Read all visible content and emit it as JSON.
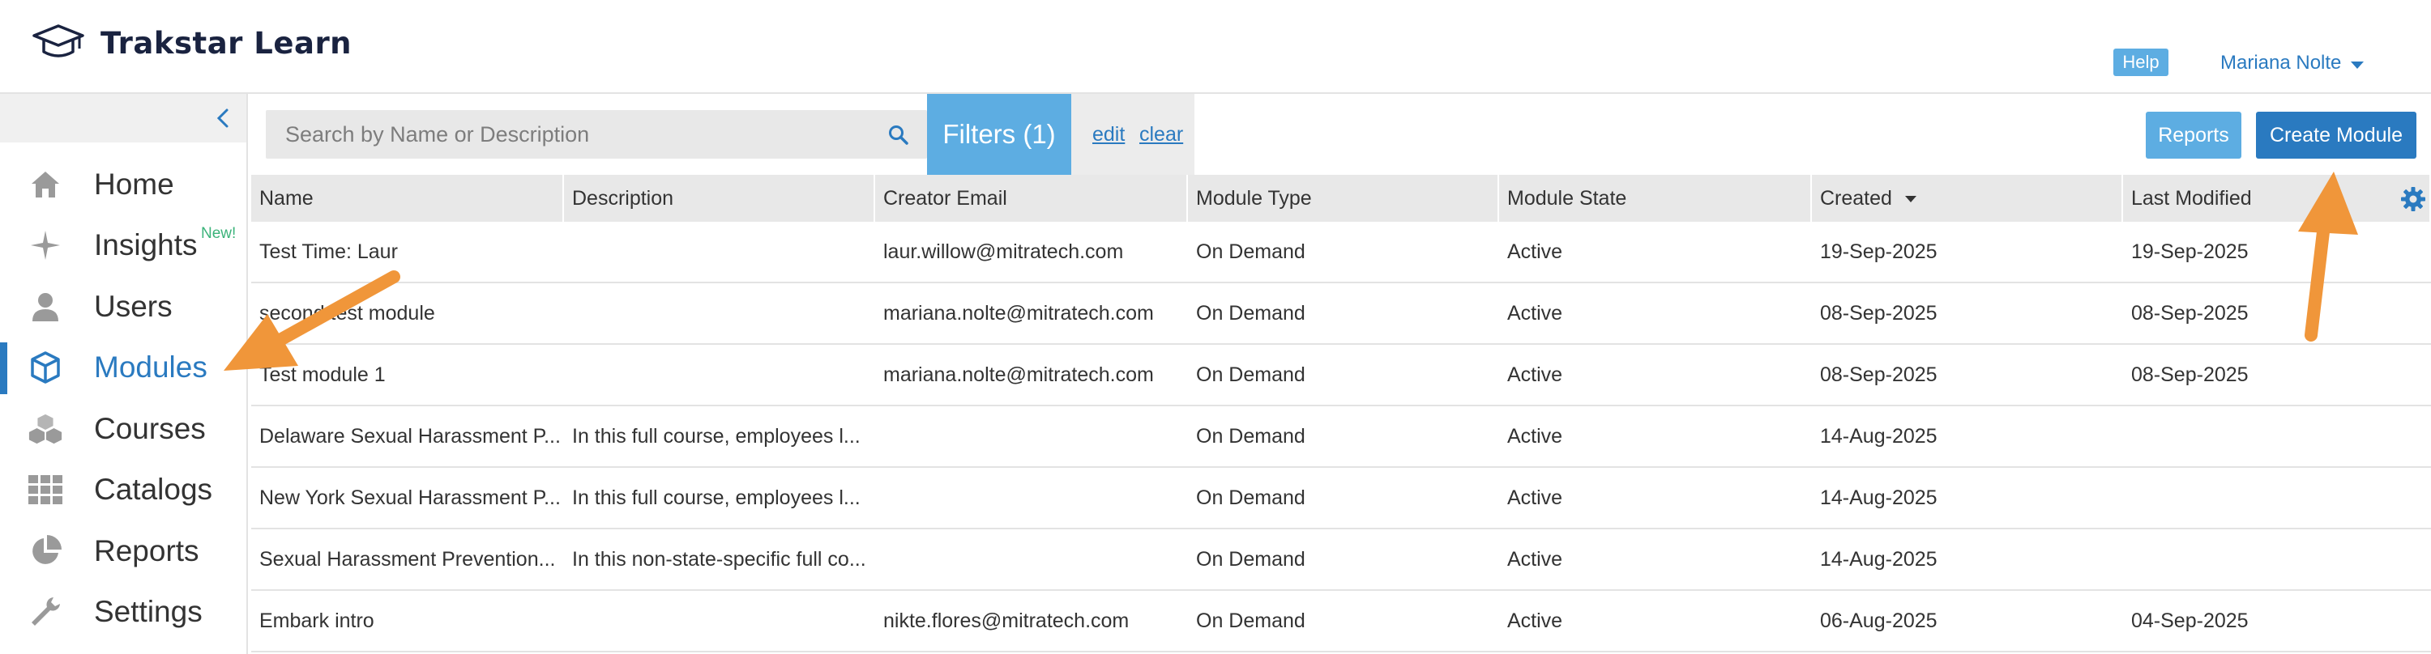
{
  "app": {
    "title": "Trakstar Learn",
    "help_label": "Help",
    "user_name": "Mariana Nolte"
  },
  "sidebar": {
    "items": [
      {
        "label": "Home",
        "icon": "home-icon"
      },
      {
        "label": "Insights",
        "icon": "sparkle-icon",
        "badge": "New!"
      },
      {
        "label": "Users",
        "icon": "user-icon"
      },
      {
        "label": "Modules",
        "icon": "cube-icon",
        "active": true
      },
      {
        "label": "Courses",
        "icon": "cubes-icon"
      },
      {
        "label": "Catalogs",
        "icon": "grid-icon"
      },
      {
        "label": "Reports",
        "icon": "pie-chart-icon"
      },
      {
        "label": "Settings",
        "icon": "wrench-icon"
      }
    ]
  },
  "toolbar": {
    "search_placeholder": "Search by Name or Description",
    "filters_label": "Filters (1)",
    "edit_label": "edit",
    "clear_label": "clear",
    "reports_label": "Reports",
    "create_label": "Create Module"
  },
  "table": {
    "columns": [
      "Name",
      "Description",
      "Creator Email",
      "Module Type",
      "Module State",
      "Created",
      "Last Modified"
    ],
    "rows": [
      [
        "Test Time: Laur",
        "",
        "laur.willow@mitratech.com",
        "On Demand",
        "Active",
        "19-Sep-2025",
        "19-Sep-2025"
      ],
      [
        "second test module",
        "",
        "mariana.nolte@mitratech.com",
        "On Demand",
        "Active",
        "08-Sep-2025",
        "08-Sep-2025"
      ],
      [
        "Test module 1",
        "",
        "mariana.nolte@mitratech.com",
        "On Demand",
        "Active",
        "08-Sep-2025",
        "08-Sep-2025"
      ],
      [
        "Delaware Sexual Harassment P...",
        "In this full course, employees l...",
        "",
        "On Demand",
        "Active",
        "14-Aug-2025",
        ""
      ],
      [
        "New York Sexual Harassment P...",
        "In this full course, employees l...",
        "",
        "On Demand",
        "Active",
        "14-Aug-2025",
        ""
      ],
      [
        "Sexual Harassment Prevention...",
        "In this non-state-specific full co...",
        "",
        "On Demand",
        "Active",
        "14-Aug-2025",
        ""
      ],
      [
        "Embark intro",
        "",
        "nikte.flores@mitratech.com",
        "On Demand",
        "Active",
        "06-Aug-2025",
        "04-Sep-2025"
      ]
    ]
  },
  "colors": {
    "accent": "#2a7ac0",
    "light_accent": "#5dade2",
    "annotation_arrow": "#f0963a",
    "new_badge": "#3bb37a"
  }
}
